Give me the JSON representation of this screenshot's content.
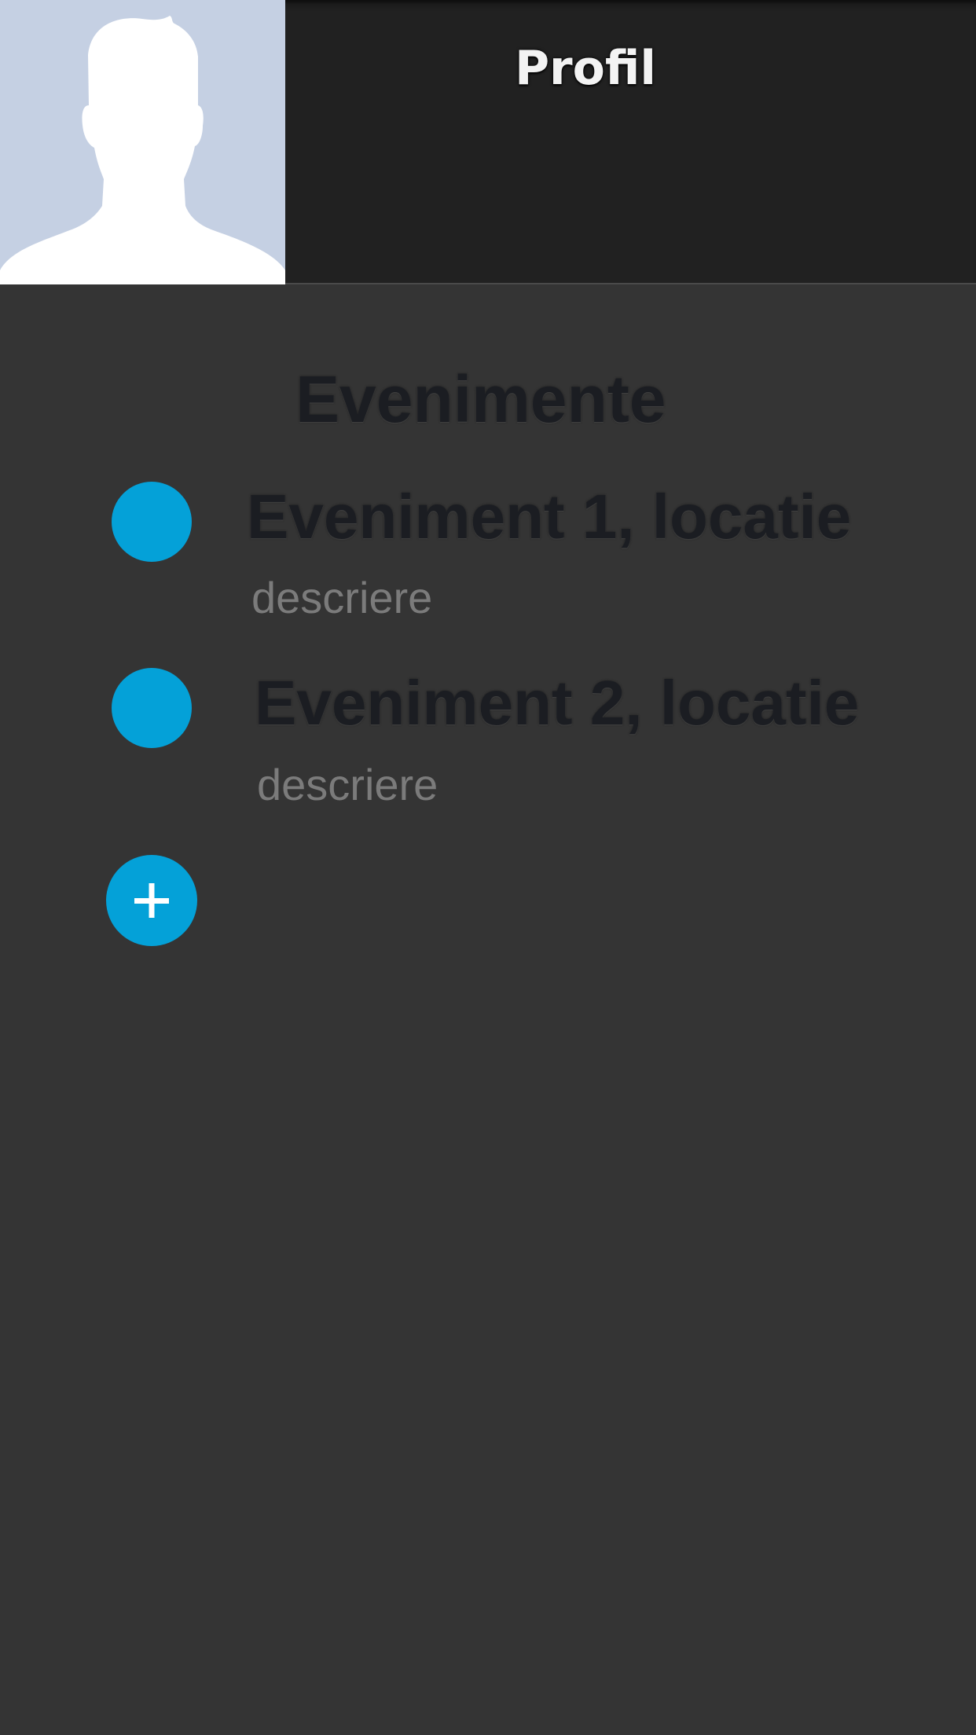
{
  "header": {
    "title": "Profil",
    "avatar_icon": "default-person-silhouette-icon"
  },
  "events": {
    "heading": "Evenimente",
    "items": [
      {
        "title": "Eveniment 1, locatie",
        "description": "descriere"
      },
      {
        "title": "Eveniment 2, locatie",
        "description": "descriere"
      }
    ],
    "add_icon": "plus-icon"
  },
  "colors": {
    "accent": "#04a1d8",
    "header_background": "#212121",
    "page_background": "#343434",
    "avatar_background": "#c5d0e3",
    "heading_text": "#1b1d22",
    "description_text": "#7b7b7b"
  }
}
